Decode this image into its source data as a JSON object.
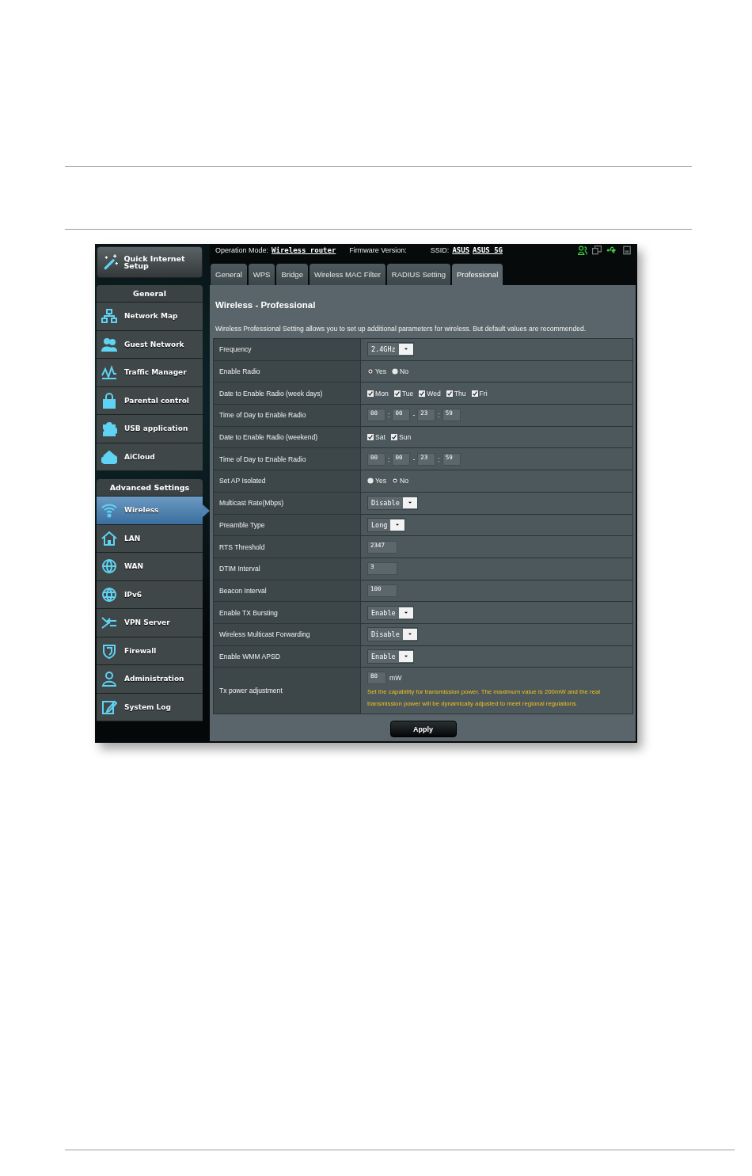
{
  "status_bar": {
    "operation_mode_label": "Operation Mode:",
    "operation_mode": "Wireless_router",
    "firmware_label": "Firmware Version:",
    "ssid_label": "SSID:",
    "ssids": [
      "ASUS",
      "ASUS_5G"
    ]
  },
  "sidebar": {
    "quick_setup": "Quick Internet Setup",
    "sections": [
      {
        "title": "General",
        "items": [
          {
            "label": "Network Map",
            "selected": false
          },
          {
            "label": "Guest Network",
            "selected": false
          },
          {
            "label": "Traffic Manager",
            "selected": false
          },
          {
            "label": "Parental control",
            "selected": false
          },
          {
            "label": "USB application",
            "selected": false
          },
          {
            "label": "AiCloud",
            "selected": false
          }
        ]
      },
      {
        "title": "Advanced Settings",
        "items": [
          {
            "label": "Wireless",
            "selected": true
          },
          {
            "label": "LAN",
            "selected": false
          },
          {
            "label": "WAN",
            "selected": false
          },
          {
            "label": "IPv6",
            "selected": false
          },
          {
            "label": "VPN Server",
            "selected": false
          },
          {
            "label": "Firewall",
            "selected": false
          },
          {
            "label": "Administration",
            "selected": false
          },
          {
            "label": "System Log",
            "selected": false
          }
        ]
      }
    ]
  },
  "tabs": [
    {
      "label": "General",
      "selected": false
    },
    {
      "label": "WPS",
      "selected": false
    },
    {
      "label": "Bridge",
      "selected": false
    },
    {
      "label": "Wireless MAC Filter",
      "selected": false
    },
    {
      "label": "RADIUS Setting",
      "selected": false
    },
    {
      "label": "Professional",
      "selected": true
    }
  ],
  "panel": {
    "title": "Wireless - Professional",
    "description": "Wireless Professional Setting allows you to set up additional parameters for wireless. But default values are recommended.",
    "rows": [
      {
        "label": "Frequency",
        "kind": "select",
        "value": "2.4GHz"
      },
      {
        "label": "Enable Radio",
        "kind": "radio",
        "options": [
          {
            "label": "Yes",
            "selected": true
          },
          {
            "label": "No",
            "selected": false
          }
        ]
      },
      {
        "label": "Date to Enable Radio (week days)",
        "kind": "checks",
        "options": [
          {
            "label": "Mon",
            "checked": true
          },
          {
            "label": "Tue",
            "checked": true
          },
          {
            "label": "Wed",
            "checked": true
          },
          {
            "label": "Thu",
            "checked": true
          },
          {
            "label": "Fri",
            "checked": true
          }
        ]
      },
      {
        "label": "Time of Day to Enable Radio",
        "kind": "time",
        "fields": [
          "00",
          "00",
          "23",
          "59"
        ],
        "separators": [
          ":",
          "-",
          ":"
        ]
      },
      {
        "label": "Date to Enable Radio (weekend)",
        "kind": "checks",
        "options": [
          {
            "label": "Sat",
            "checked": true
          },
          {
            "label": "Sun",
            "checked": true
          }
        ]
      },
      {
        "label": "Time of Day to Enable Radio",
        "kind": "time",
        "fields": [
          "00",
          "00",
          "23",
          "59"
        ],
        "separators": [
          ":",
          "-",
          ":"
        ]
      },
      {
        "label": "Set AP Isolated",
        "kind": "radio",
        "options": [
          {
            "label": "Yes",
            "selected": false
          },
          {
            "label": "No",
            "selected": true
          }
        ]
      },
      {
        "label": "Multicast Rate(Mbps)",
        "kind": "select",
        "value": "Disable"
      },
      {
        "label": "Preamble Type",
        "kind": "select",
        "value": "Long"
      },
      {
        "label": "RTS Threshold",
        "kind": "text",
        "value": "2347"
      },
      {
        "label": "DTIM Interval",
        "kind": "text",
        "value": "3"
      },
      {
        "label": "Beacon Interval",
        "kind": "text",
        "value": "100"
      },
      {
        "label": "Enable TX Bursting",
        "kind": "select",
        "value": "Enable"
      },
      {
        "label": "Wireless Multicast Forwarding",
        "kind": "select",
        "value": "Disable"
      },
      {
        "label": "Enable WMM APSD",
        "kind": "select",
        "value": "Enable"
      },
      {
        "label": "Tx power adjustment",
        "kind": "power",
        "value": "80",
        "unit": "mW",
        "note": "Set the capability for transmission power. The maximum value is 200mW and the real transmission power will be dynamically adjusted to meet regional regulations"
      }
    ],
    "apply": "Apply"
  }
}
